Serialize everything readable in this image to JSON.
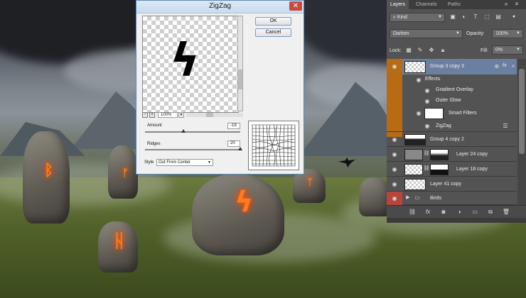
{
  "dialog": {
    "title": "ZigZag",
    "close_glyph": "✕",
    "ok_label": "OK",
    "cancel_label": "Cancel",
    "zoom_minus": "−",
    "zoom_plus": "+",
    "zoom_value": "100%",
    "amount_label": "Amount",
    "amount_value": "-19",
    "amount_level": 0.405,
    "ridges_label": "Ridges",
    "ridges_value": "20",
    "ridges_level": 1.0,
    "style_label": "Style",
    "style_value": "Out From Center",
    "preview_glyph": "ϟ"
  },
  "panel": {
    "tabs": [
      "Layers",
      "Channels",
      "Paths"
    ],
    "kind_label": "Kind",
    "blend_mode": "Darken",
    "opacity_label": "Opacity:",
    "opacity_value": "100%",
    "lock_label": "Lock:",
    "fill_label": "Fill:",
    "fill_value": "0%",
    "layers": [
      {
        "name": "Group 3 copy 3"
      },
      {
        "name": "Effects"
      },
      {
        "name": "Gradient Overlay"
      },
      {
        "name": "Outer Glow"
      },
      {
        "name": "Smart Filters"
      },
      {
        "name": "ZigZag"
      },
      {
        "name": "Group 4 copy 2"
      },
      {
        "name": "Layer 24 copy"
      },
      {
        "name": "Layer 18 copy"
      },
      {
        "name": "Layer 41 copy"
      },
      {
        "name": "Birds"
      }
    ],
    "fx_label": "fx",
    "footer_icons": [
      "link-icon",
      "fx-icon",
      "mask-icon",
      "adjustment-icon",
      "folder-icon",
      "new-layer-icon",
      "trash-icon"
    ]
  },
  "colors": {
    "selected_layer": "#6b7fa0",
    "orange_group": "#b76b12",
    "red_group": "#b8443a",
    "rune_glow": "#ff7a1a"
  }
}
